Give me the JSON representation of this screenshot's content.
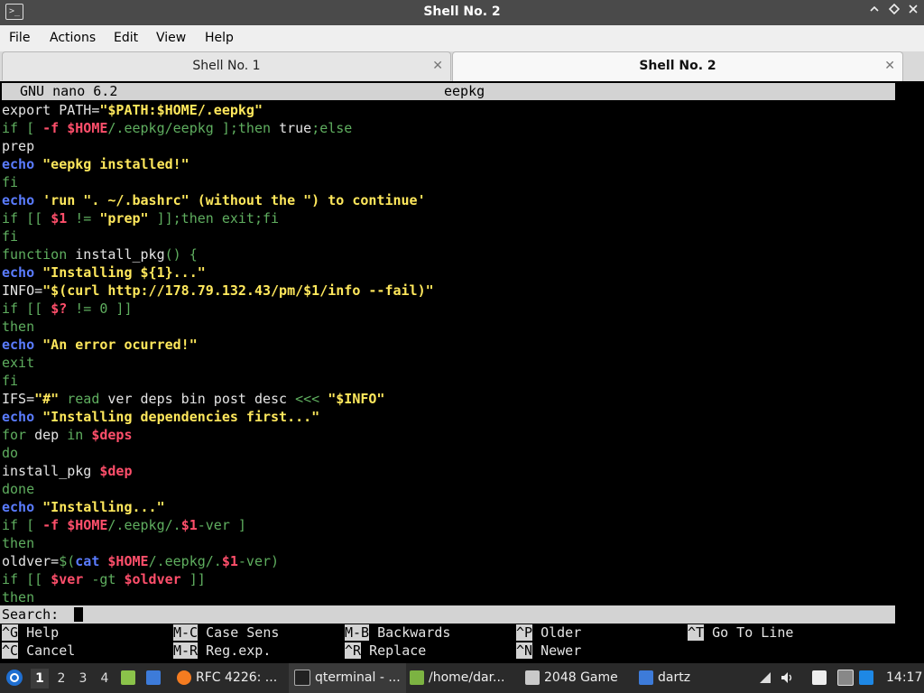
{
  "window": {
    "title": "Shell No. 2",
    "app_icon": ">_",
    "minimize_icon": "chevron-up-icon",
    "restore_icon": "diamond-icon",
    "close_icon": "close-icon"
  },
  "menu": [
    "File",
    "Actions",
    "Edit",
    "View",
    "Help"
  ],
  "tabs": [
    {
      "label": "Shell No. 1",
      "active": false
    },
    {
      "label": "Shell No. 2",
      "active": true
    }
  ],
  "nano": {
    "version": "GNU nano 6.2",
    "filename": "eepkg",
    "lines": [
      [
        [
          "w",
          "export PATH="
        ],
        [
          "y",
          "\"$PATH:$HOME/.eepkg\""
        ]
      ],
      [
        [
          "g",
          "if [ "
        ],
        [
          "r",
          "-f"
        ],
        [
          "w",
          " "
        ],
        [
          "r",
          "$HOME"
        ],
        [
          "g",
          "/.eepkg/eepkg ];then "
        ],
        [
          "w",
          "true"
        ],
        [
          "g",
          ";else"
        ]
      ],
      [
        [
          "w",
          "prep"
        ]
      ],
      [
        [
          "b",
          "echo"
        ],
        [
          "w",
          " "
        ],
        [
          "y",
          "\"eepkg installed!\""
        ]
      ],
      [
        [
          "g",
          "fi"
        ]
      ],
      [
        [
          "b",
          "echo"
        ],
        [
          "w",
          " "
        ],
        [
          "y",
          "'run \". ~/.bashrc\" (without the \") to continue'"
        ]
      ],
      [
        [
          "g",
          "if [[ "
        ],
        [
          "r",
          "$1"
        ],
        [
          "g",
          " != "
        ],
        [
          "y",
          "\"prep\""
        ],
        [
          "g",
          " ]];then exit;fi"
        ]
      ],
      [
        [
          "g",
          "fi"
        ]
      ],
      [
        [
          "g",
          "function "
        ],
        [
          "w",
          "install_pkg"
        ],
        [
          "g",
          "() {"
        ]
      ],
      [
        [
          "b",
          "echo"
        ],
        [
          "w",
          " "
        ],
        [
          "y",
          "\"Installing ${1}...\""
        ]
      ],
      [
        [
          "w",
          "INFO="
        ],
        [
          "y",
          "\"$(curl http://178.79.132.43/pm/$1/info --fail)\""
        ]
      ],
      [
        [
          "g",
          "if [[ "
        ],
        [
          "r",
          "$?"
        ],
        [
          "g",
          " != 0 ]]"
        ]
      ],
      [
        [
          "g",
          "then"
        ]
      ],
      [
        [
          "b",
          "echo"
        ],
        [
          "w",
          " "
        ],
        [
          "y",
          "\"An error ocurred!\""
        ]
      ],
      [
        [
          "g",
          "exit"
        ]
      ],
      [
        [
          "g",
          "fi"
        ]
      ],
      [
        [
          "w",
          "IFS="
        ],
        [
          "y",
          "\"#\""
        ],
        [
          "w",
          " "
        ],
        [
          "g",
          "read"
        ],
        [
          "w",
          " ver deps bin post desc "
        ],
        [
          "g",
          "<<<"
        ],
        [
          "w",
          " "
        ],
        [
          "y",
          "\"$INFO\""
        ]
      ],
      [
        [
          "b",
          "echo"
        ],
        [
          "w",
          " "
        ],
        [
          "y",
          "\"Installing dependencies first...\""
        ]
      ],
      [
        [
          "g",
          "for "
        ],
        [
          "w",
          "dep "
        ],
        [
          "g",
          "in "
        ],
        [
          "r",
          "$deps"
        ]
      ],
      [
        [
          "g",
          "do"
        ]
      ],
      [
        [
          "w",
          "install_pkg "
        ],
        [
          "r",
          "$dep"
        ]
      ],
      [
        [
          "g",
          "done"
        ]
      ],
      [
        [
          "b",
          "echo"
        ],
        [
          "w",
          " "
        ],
        [
          "y",
          "\"Installing...\""
        ]
      ],
      [
        [
          "g",
          "if [ "
        ],
        [
          "r",
          "-f"
        ],
        [
          "w",
          " "
        ],
        [
          "r",
          "$HOME"
        ],
        [
          "g",
          "/.eepkg/."
        ],
        [
          "r",
          "$1"
        ],
        [
          "g",
          "-ver ]"
        ]
      ],
      [
        [
          "g",
          "then"
        ]
      ],
      [
        [
          "w",
          "oldver="
        ],
        [
          "g",
          "$("
        ],
        [
          "b",
          "cat"
        ],
        [
          "w",
          " "
        ],
        [
          "r",
          "$HOME"
        ],
        [
          "g",
          "/.eepkg/."
        ],
        [
          "r",
          "$1"
        ],
        [
          "g",
          "-ver)"
        ]
      ],
      [
        [
          "g",
          "if [[ "
        ],
        [
          "r",
          "$ver"
        ],
        [
          "g",
          " -gt "
        ],
        [
          "r",
          "$oldver"
        ],
        [
          "g",
          " ]]"
        ]
      ],
      [
        [
          "g",
          "then"
        ]
      ]
    ],
    "search_label": "Search:",
    "shortcuts": [
      {
        "key": "^G",
        "label": "Help"
      },
      {
        "key": "M-C",
        "label": "Case Sens"
      },
      {
        "key": "M-B",
        "label": "Backwards"
      },
      {
        "key": "^P",
        "label": "Older"
      },
      {
        "key": "^T",
        "label": "Go To Line"
      },
      {
        "key": "^C",
        "label": "Cancel"
      },
      {
        "key": "M-R",
        "label": "Reg.exp."
      },
      {
        "key": "^R",
        "label": "Replace"
      },
      {
        "key": "^N",
        "label": "Newer"
      }
    ]
  },
  "taskbar": {
    "workspaces": [
      "1",
      "2",
      "3",
      "4"
    ],
    "current_workspace": "1",
    "tasks": [
      {
        "label": "RFC 4226: ...",
        "icon": "firefox-icon"
      },
      {
        "label": "qterminal - ...",
        "icon": "terminal-icon"
      },
      {
        "label": "/home/dar...",
        "icon": "file-manager-icon"
      },
      {
        "label": "2048 Game",
        "icon": "game-window-icon"
      },
      {
        "label": "dartz",
        "icon": "folder-icon"
      }
    ],
    "clock": "14:17"
  }
}
